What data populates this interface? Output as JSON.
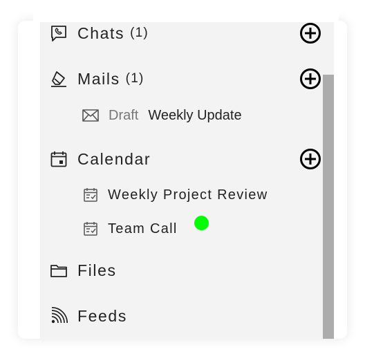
{
  "sections": {
    "chats": {
      "label": "Chats",
      "count": "(1)",
      "icon": "phone-chat-icon"
    },
    "mails": {
      "label": "Mails",
      "count": "(1)",
      "icon": "eraser-icon"
    },
    "calendar": {
      "label": "Calendar",
      "icon": "calendar-icon"
    },
    "files": {
      "label": "Files",
      "icon": "folder-icon"
    },
    "feeds": {
      "label": "Feeds",
      "icon": "rss-icon"
    }
  },
  "mail_items": [
    {
      "tag": "Draft",
      "subject": "Weekly Update",
      "icon": "envelope-icon"
    }
  ],
  "calendar_items": [
    {
      "label": "Weekly Project Review",
      "icon": "calendar-check-icon"
    },
    {
      "label": "Team Call",
      "icon": "calendar-check-icon",
      "status": "online"
    }
  ],
  "colors": {
    "panel_bg": "#f3f3f3",
    "scrollbar_thumb": "#acacac",
    "status_dot": "#00ff00",
    "draft_text": "#777777",
    "text": "#222222"
  }
}
